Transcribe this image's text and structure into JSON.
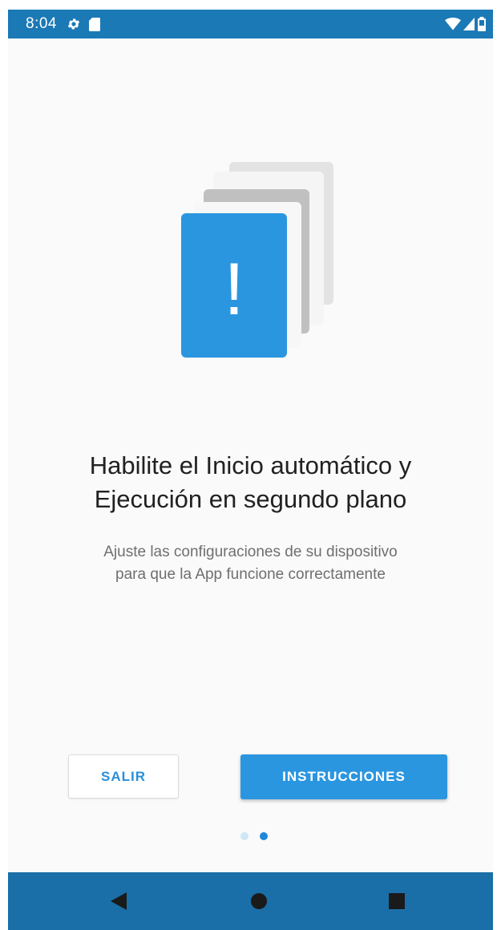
{
  "status_bar": {
    "time": "8:04",
    "icons": [
      "gear-icon",
      "sd-card-icon",
      "wifi-icon",
      "signal-icon",
      "battery-icon"
    ]
  },
  "illustration": {
    "symbol": "!",
    "accent_color": "#2b96e0"
  },
  "main": {
    "title_line1": "Habilite el Inicio automático y",
    "title_line2": "Ejecución en segundo plano",
    "subtitle_line1": "Ajuste las configuraciones de su dispositivo",
    "subtitle_line2": "para que la App funcione correctamente"
  },
  "buttons": {
    "exit_label": "SALIR",
    "instructions_label": "INSTRUCCIONES"
  },
  "pager": {
    "total_pages": 2,
    "current_page": 2
  },
  "nav_bar": {
    "icons": [
      "back-icon",
      "home-icon",
      "recents-icon"
    ]
  },
  "colors": {
    "status_bar": "#1b79b5",
    "nav_bar": "#1b6fa8",
    "primary": "#2b96e0",
    "background": "#fafafa"
  }
}
